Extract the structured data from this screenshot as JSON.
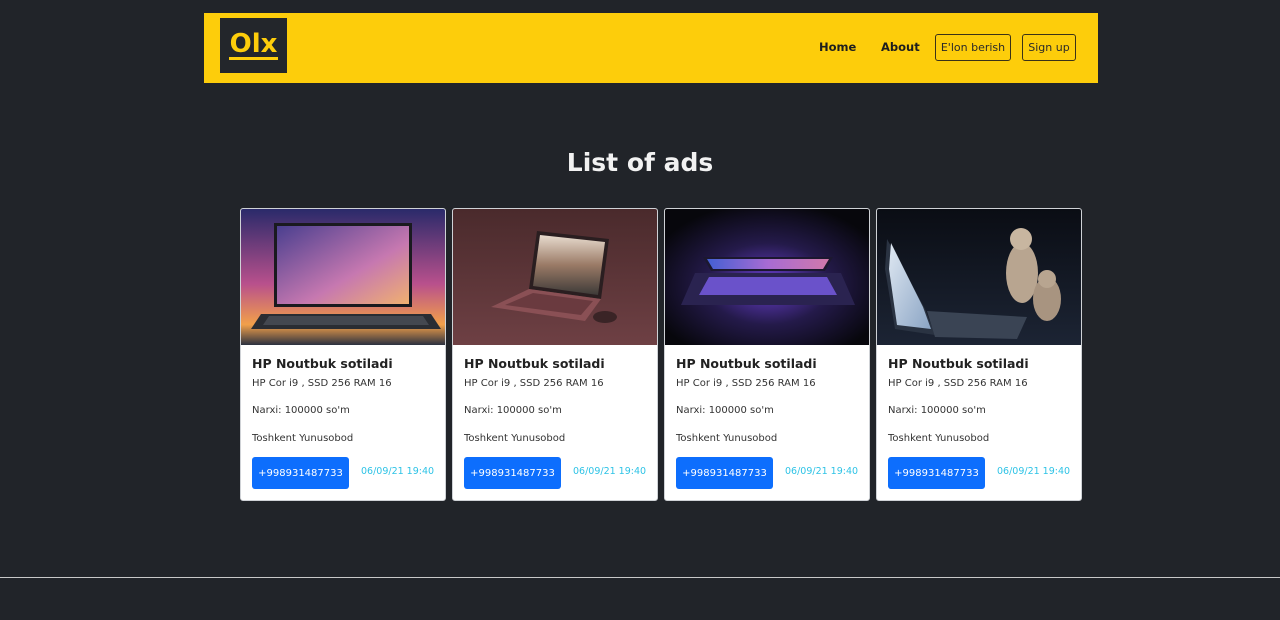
{
  "navbar": {
    "logo_text": "Olx",
    "links": [
      "Home",
      "About"
    ],
    "post_ad_label": "E'lon berish",
    "signup_label": "Sign up",
    "accent_color": "#fdcd0b"
  },
  "page": {
    "heading": "List of ads"
  },
  "ads": [
    {
      "title": "HP Noutbuk sotiladi",
      "specs": "HP Cor i9 , SSD 256 RAM 16",
      "price": "Narxi: 100000 so'm",
      "location": "Toshkent Yunusobod",
      "phone": "+998931487733",
      "date": "06/09/21 19:40",
      "image": "laptop-galaxy-photo"
    },
    {
      "title": "HP Noutbuk sotiladi",
      "specs": "HP Cor i9 , SSD 256 RAM 16",
      "price": "Narxi: 100000 so'm",
      "location": "Toshkent Yunusobod",
      "phone": "+998931487733",
      "date": "06/09/21 19:40",
      "image": "laptop-maroon-photo"
    },
    {
      "title": "HP Noutbuk sotiladi",
      "specs": "HP Cor i9 , SSD 256 RAM 16",
      "price": "Narxi: 100000 so'm",
      "location": "Toshkent Yunusobod",
      "phone": "+998931487733",
      "date": "06/09/21 19:40",
      "image": "laptop-purple-glow-photo"
    },
    {
      "title": "HP Noutbuk sotiladi",
      "specs": "HP Cor i9 , SSD 256 RAM 16",
      "price": "Narxi: 100000 so'm",
      "location": "Toshkent Yunusobod",
      "phone": "+998931487733",
      "date": "06/09/21 19:40",
      "image": "laptop-cats-photo"
    }
  ]
}
